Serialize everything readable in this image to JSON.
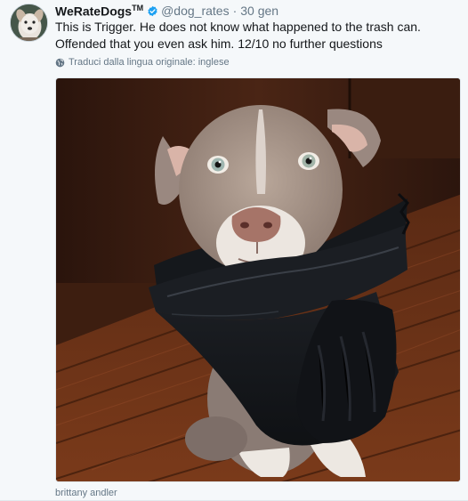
{
  "tweet": {
    "display_name": "WeRateDogs",
    "tm_mark": "TM",
    "handle": "@dog_rates",
    "separator": "·",
    "timestamp": "30 gen",
    "text": "This is Trigger. He does not know what happened to the trash can. Offended that you even ask him. 12/10 no further questions",
    "translate_label": "Traduci dalla lingua originale: inglese",
    "photo_credit": "brittany andler",
    "icons": {
      "verified": "verified-badge-icon",
      "translate": "globe-icon"
    }
  },
  "colors": {
    "secondary_text": "#657786",
    "primary_text": "#14171a",
    "verified_blue": "#1da1f2",
    "background": "#f5f8fa"
  }
}
